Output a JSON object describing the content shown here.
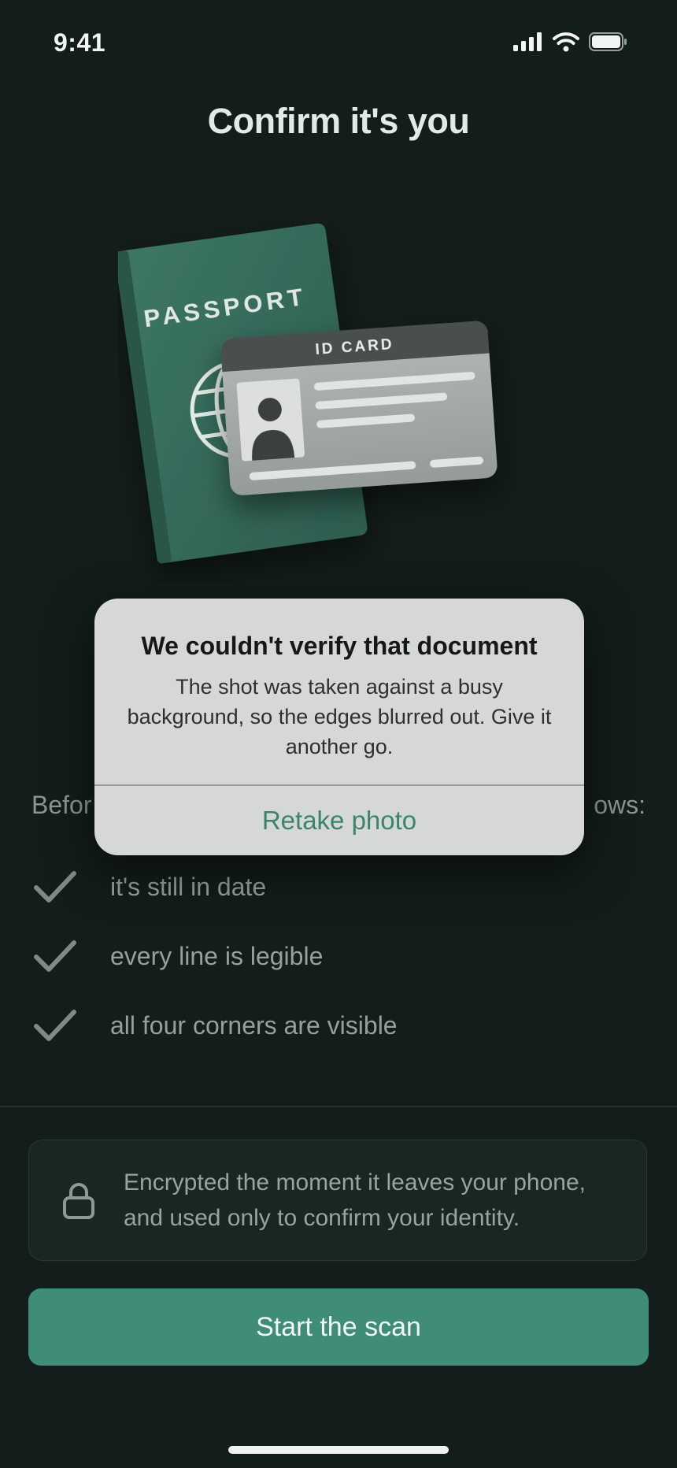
{
  "status_bar": {
    "time": "9:41"
  },
  "screen": {
    "title": "Confirm it's you"
  },
  "illustration": {
    "passport_label": "PASSPORT",
    "id_card_label": "ID CARD"
  },
  "checklist": {
    "intro_left": "Befor",
    "intro_right": "ows:",
    "items": [
      {
        "label": "it's still in date"
      },
      {
        "label": "every line is legible"
      },
      {
        "label": "all four corners are visible"
      }
    ]
  },
  "privacy": {
    "text": "Encrypted the moment it leaves your phone, and used only to confirm your identity."
  },
  "primary_button": {
    "label": "Start the scan"
  },
  "dialog": {
    "title": "We couldn't verify that document",
    "message": "The shot was taken against a busy background, so the edges blurred out. Give it another go.",
    "action_label": "Retake photo"
  },
  "colors": {
    "background": "#131d1b",
    "accent": "#3f8d76",
    "dialog_background": "#d6d8d6",
    "dialog_action": "#3a8469"
  }
}
